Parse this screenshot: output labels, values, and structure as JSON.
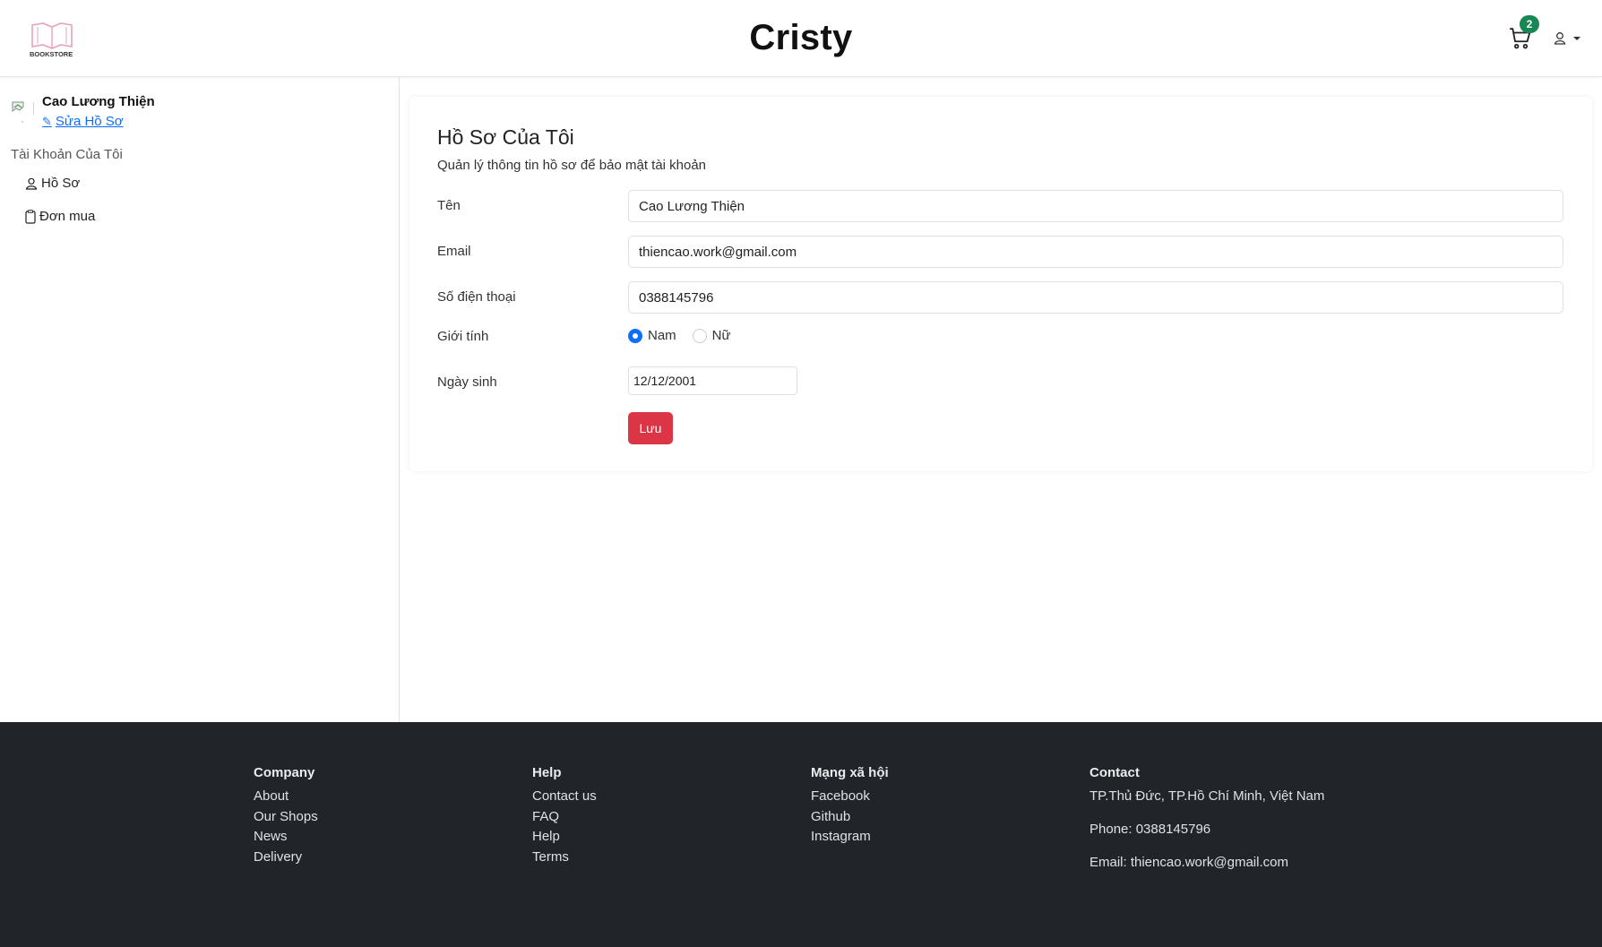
{
  "header": {
    "brand": "Cristy",
    "logo_text": "BOOKSTORE",
    "cart_count": "2",
    "icons": {
      "cart": "cart-icon",
      "user": "user-icon",
      "caret": "caret-down-icon"
    }
  },
  "sidebar": {
    "username": "Cao Lương Thiện",
    "edit_profile": "Sửa Hồ Sơ",
    "account_heading": "Tài Khoản Của Tôi",
    "items": [
      {
        "label": "Hồ Sơ",
        "icon": "user-icon"
      },
      {
        "label": "Đơn mua",
        "icon": "clipboard-icon"
      }
    ]
  },
  "profile": {
    "title": "Hồ Sơ Của Tôi",
    "subtitle": "Quản lý thông tin hồ sơ để bảo mật tài khoản",
    "name_label": "Tên",
    "name_value": "Cao Lương Thiện",
    "email_label": "Email",
    "email_value": "thiencao.work@gmail.com",
    "phone_label": "Số điện thoại",
    "phone_value": "0388145796",
    "gender_label": "Giới tính",
    "gender_options": [
      "Nam",
      "Nữ"
    ],
    "gender_selected": "Nam",
    "dob_label": "Ngày sinh",
    "dob_value": "12/12/2001",
    "save_label": "Lưu"
  },
  "footer": {
    "company": {
      "title": "Company",
      "links": [
        "About",
        "Our Shops",
        "News",
        "Delivery"
      ]
    },
    "help": {
      "title": "Help",
      "links": [
        "Contact us",
        "FAQ",
        "Help",
        "Terms"
      ]
    },
    "social": {
      "title": "Mạng xã hội",
      "links": [
        "Facebook",
        "Github",
        "Instagram"
      ]
    },
    "contact": {
      "title": "Contact",
      "address": "TP.Thủ Đức, TP.Hồ Chí Minh, Việt Nam",
      "phone": "Phone: 0388145796",
      "email": "Email: thiencao.work@gmail.com"
    }
  },
  "colors": {
    "primary": "#0d6efd",
    "danger": "#dc3545",
    "success_badge": "#198754",
    "footer_bg": "#212529",
    "logo_pink": "#e7a3b6"
  }
}
